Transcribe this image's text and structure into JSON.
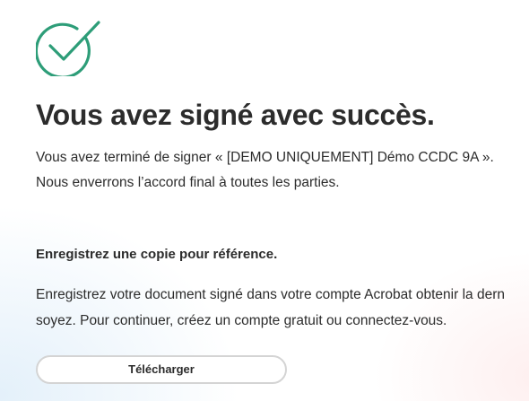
{
  "success": {
    "icon": "check-circle-icon",
    "accent_color": "#2d9d78",
    "title": "Vous avez signé avec succès.",
    "message_line1": "Vous avez terminé de signer « [DEMO UNIQUEMENT] Démo CCDC 9A ».",
    "message_line2": "Nous enverrons l’accord final à toutes les parties."
  },
  "save_copy": {
    "heading": "Enregistrez une copie pour référence.",
    "text_line1": "Enregistrez votre document signé dans votre compte Acrobat obtenir la dern",
    "text_line2": "soyez. Pour continuer, créez un compte gratuit ou connectez-vous.",
    "download_label": "Télécharger"
  }
}
